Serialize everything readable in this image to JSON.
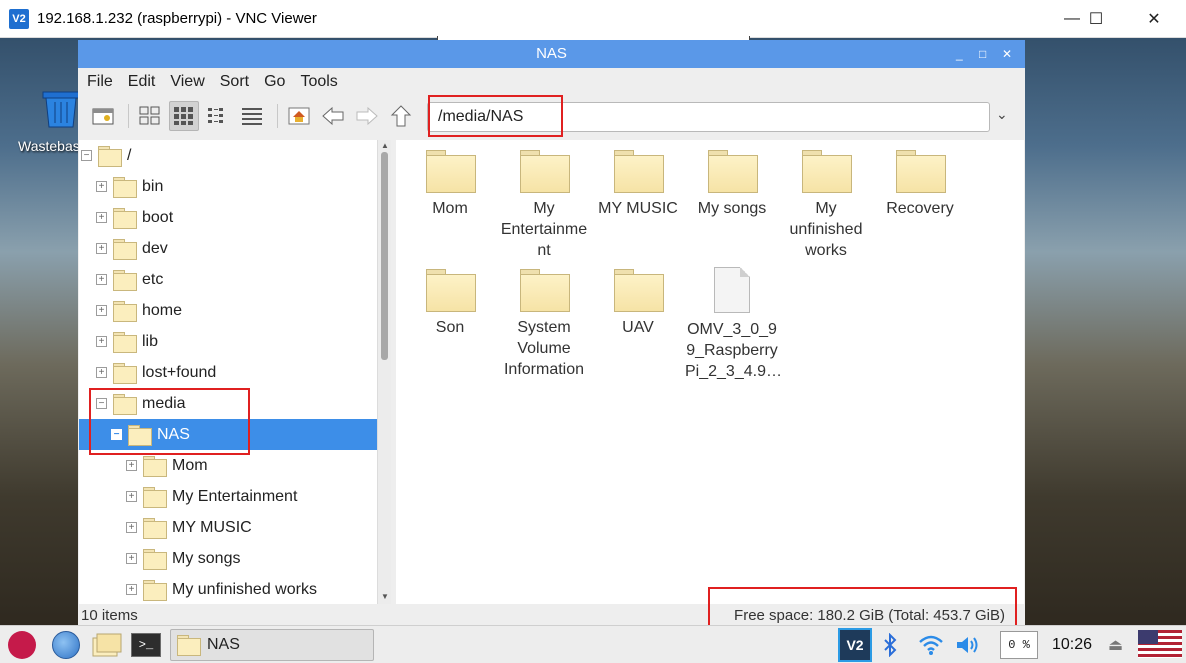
{
  "vnc": {
    "logo": "V2",
    "title": "192.168.1.232 (raspberrypi) - VNC Viewer",
    "minimize": "—",
    "maximize": "☐",
    "close": "✕"
  },
  "desktop": {
    "trash_label": "Wastebasket"
  },
  "window": {
    "title": "NAS",
    "controls": [
      "_",
      "□",
      "✕"
    ]
  },
  "menu": [
    "File",
    "Edit",
    "View",
    "Sort",
    "Go",
    "Tools"
  ],
  "toolbar": {
    "path": "/media/NAS",
    "icons": [
      "new-window-icon",
      "icon-view-icon",
      "thumbnail-view-icon",
      "compact-view-icon",
      "list-view-icon",
      "home-icon",
      "back-icon",
      "forward-icon",
      "up-icon"
    ]
  },
  "tree": [
    {
      "label": "/",
      "exp": "−",
      "indent": 0
    },
    {
      "label": "bin",
      "exp": "+",
      "indent": 1
    },
    {
      "label": "boot",
      "exp": "+",
      "indent": 1
    },
    {
      "label": "dev",
      "exp": "+",
      "indent": 1
    },
    {
      "label": "etc",
      "exp": "+",
      "indent": 1
    },
    {
      "label": "home",
      "exp": "+",
      "indent": 1
    },
    {
      "label": "lib",
      "exp": "+",
      "indent": 1
    },
    {
      "label": "lost+found",
      "exp": "+",
      "indent": 1
    },
    {
      "label": "media",
      "exp": "−",
      "indent": 1
    },
    {
      "label": "NAS",
      "exp": "−",
      "indent": 2,
      "selected": true
    },
    {
      "label": "Mom",
      "exp": "+",
      "indent": 3
    },
    {
      "label": "My Entertainment",
      "exp": "+",
      "indent": 3
    },
    {
      "label": "MY MUSIC",
      "exp": "+",
      "indent": 3
    },
    {
      "label": "My songs",
      "exp": "+",
      "indent": 3
    },
    {
      "label": "My unfinished works",
      "exp": "+",
      "indent": 3
    }
  ],
  "icons": [
    {
      "label": "Mom",
      "type": "folder"
    },
    {
      "label": "My\nEntertainme\nnt",
      "type": "folder"
    },
    {
      "label": "MY MUSIC",
      "type": "folder"
    },
    {
      "label": "My songs",
      "type": "folder"
    },
    {
      "label": "My\nunfinished\nworks",
      "type": "folder"
    },
    {
      "label": "Recovery",
      "type": "folder"
    },
    {
      "label": "Son",
      "type": "folder"
    },
    {
      "label": "System\nVolume\nInformation",
      "type": "folder"
    },
    {
      "label": "UAV",
      "type": "folder"
    },
    {
      "label": "OMV_3_0_9\n9_Raspberry\nPi_2_3_4.9…",
      "type": "file"
    }
  ],
  "status": {
    "items": "10 items",
    "free_space": "Free space: 180.2 GiB (Total: 453.7 GiB)"
  },
  "taskbar": {
    "terminal_glyph": ">_",
    "task_label": "NAS",
    "vnc_tray": "V2",
    "cpu": "0 %",
    "clock": "10:26"
  }
}
